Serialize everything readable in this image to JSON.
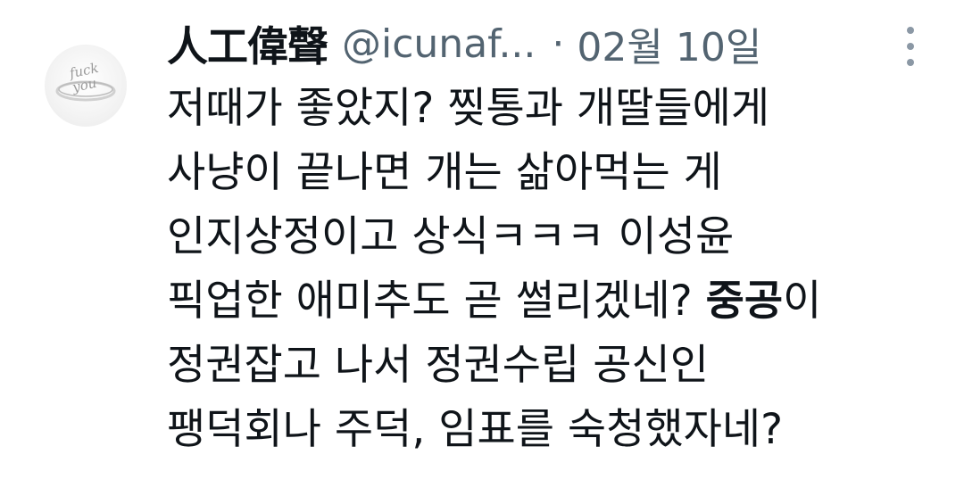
{
  "tweet": {
    "display_name": "人工偉聲",
    "handle": "@icunaf...",
    "separator": "·",
    "date": "02월 10일",
    "avatar_text": "fuck you",
    "more_icon": "more-vertical-icon",
    "lines": [
      "저때가 좋았지? 찢통과 개딸들에게",
      "사냥이 끝나면 개는 삶아먹는 게",
      "인지상정이고 상식ㅋㅋㅋ 이성윤"
    ],
    "line4_before": "픽업한 애미추도 곧 썰리겠네? ",
    "line4_bold": "중공",
    "line4_after": "이",
    "lines_tail": [
      "정권잡고 나서 정권수립 공신인",
      "팽덕회나 주덕, 임표를 숙청했자네?"
    ]
  },
  "colors": {
    "text": "#0f1419",
    "secondary": "#536471",
    "icon": "#8b98a5"
  }
}
